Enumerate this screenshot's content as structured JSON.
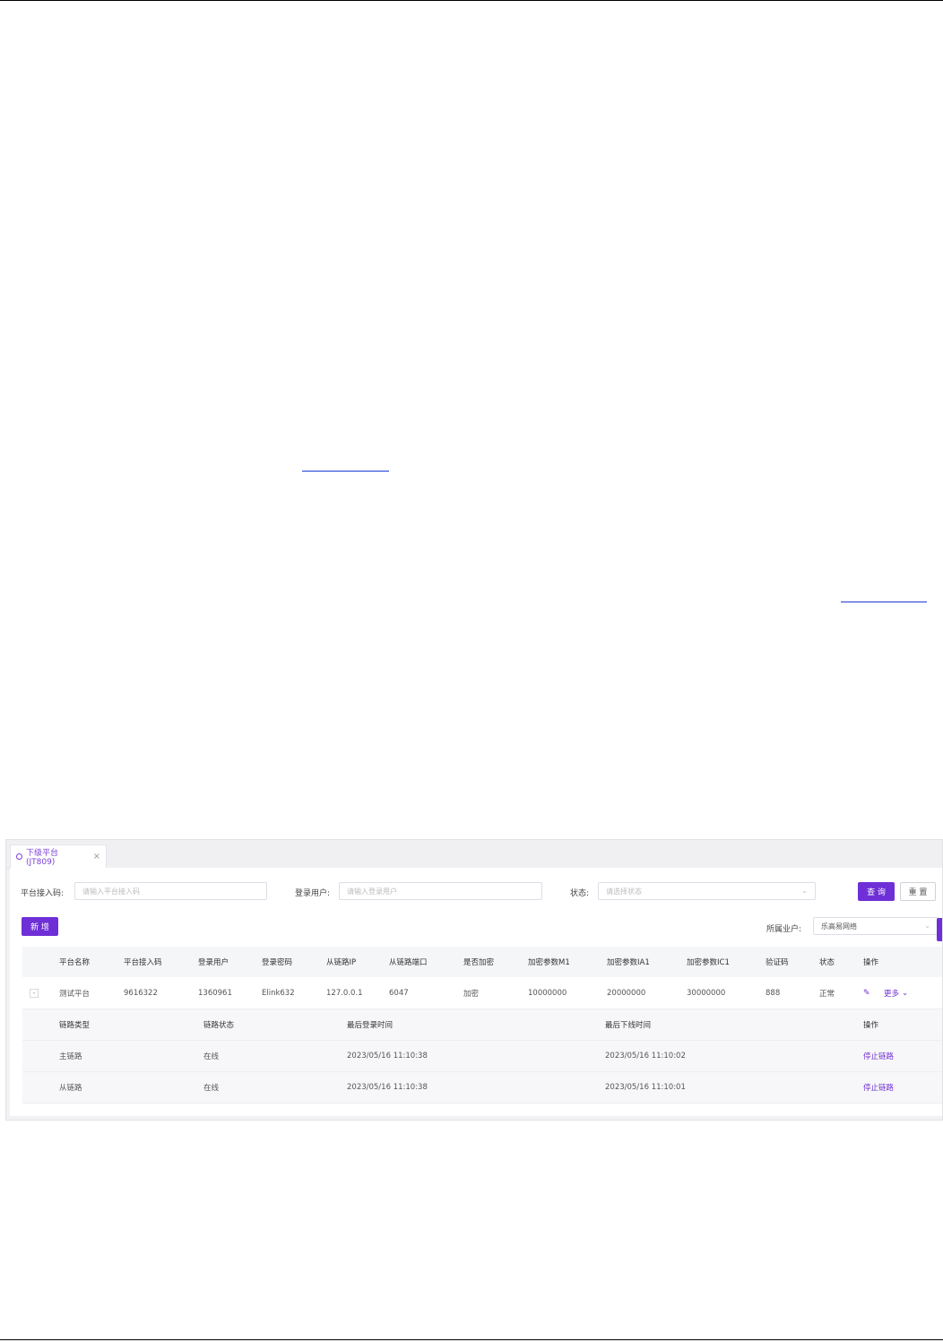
{
  "tab": {
    "label": "下级平台(JT809)",
    "close": "×"
  },
  "filters": {
    "code_label": "平台接入码:",
    "code_placeholder": "请输入平台接入码",
    "user_label": "登录用户:",
    "user_placeholder": "请输入登录用户",
    "status_label": "状态:",
    "status_placeholder": "请选择状态",
    "query_button": "查 询",
    "reset_button": "重 置"
  },
  "toolbar": {
    "add_button": "新 增",
    "tenant_label": "所属业户:",
    "tenant_value": "乐高易网络"
  },
  "table": {
    "headers": [
      "平台名称",
      "平台接入码",
      "登录用户",
      "登录密码",
      "从链路IP",
      "从链路端口",
      "是否加密",
      "加密参数M1",
      "加密参数IA1",
      "加密参数IC1",
      "验证码",
      "状态",
      "操作"
    ],
    "row": {
      "expand": "-",
      "cells": [
        "测试平台",
        "9616322",
        "1360961",
        "Elink632",
        "127.0.0.1",
        "6047",
        "加密",
        "10000000",
        "20000000",
        "30000000",
        "888",
        "正常"
      ],
      "more": "更多",
      "more_chevron": "⌄"
    },
    "sub_headers": [
      "链路类型",
      "链路状态",
      "最后登录时间",
      "最后下线时间",
      "操作"
    ],
    "sub_rows": [
      [
        "主链路",
        "在线",
        "2023/05/16 11:10:38",
        "2023/05/16 11:10:02",
        "停止链路"
      ],
      [
        "从链路",
        "在线",
        "2023/05/16 11:10:38",
        "2023/05/16 11:10:01",
        "停止链路"
      ]
    ]
  },
  "icons": {
    "edit": "pencil-icon",
    "loading": "spinner-icon",
    "select_arrow": "chevron-down-icon"
  },
  "colors": {
    "accent": "#6f2fd6"
  }
}
